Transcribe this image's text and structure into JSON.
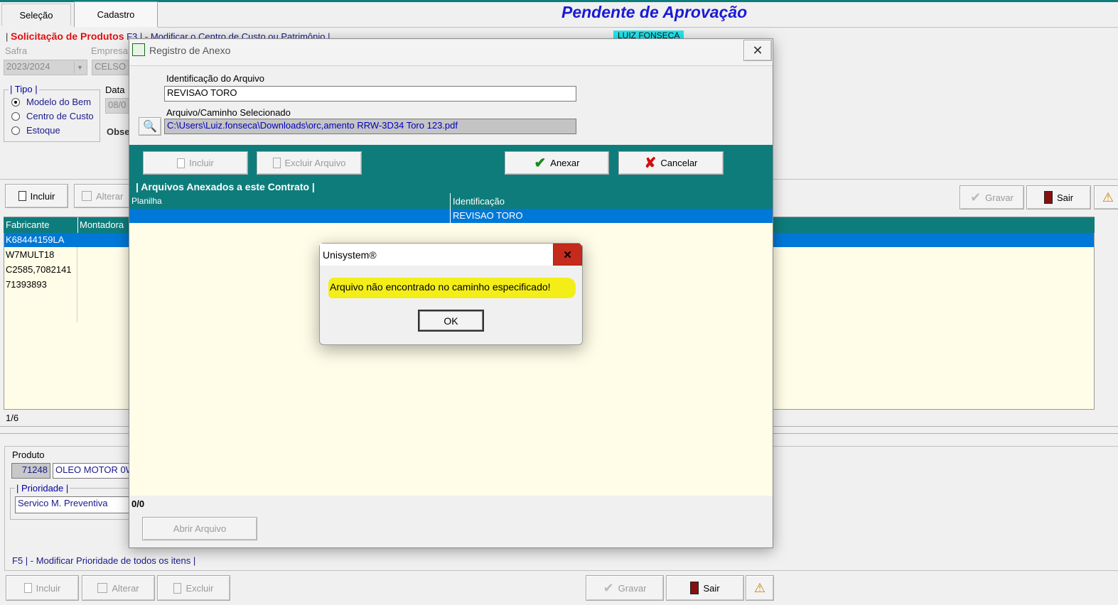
{
  "tabs": [
    {
      "label": "Seleção"
    },
    {
      "label": "Cadastro"
    }
  ],
  "status_title": "Pendente de Aprovação",
  "header_bar": {
    "section": "Solicitação de Produtos",
    "hint": "F3 | - Modificar o Centro de Custo ou Patrimônio |",
    "user_tag": "LUIZ FONSECA"
  },
  "filters": {
    "safra_label": "Safra",
    "safra_value": "2023/2024",
    "empresa_label": "Empresa",
    "empresa_value": "CELSO",
    "data_label": "Data",
    "data_value": "08/0",
    "obs_label": "Obse"
  },
  "tipo": {
    "title": "Tipo",
    "options": [
      {
        "label": "Modelo do Bem",
        "checked": true
      },
      {
        "label": "Centro de Custo",
        "checked": false
      },
      {
        "label": "Estoque",
        "checked": false
      }
    ]
  },
  "toolbar_top": {
    "incluir": "Incluir",
    "alterar": "Alterar",
    "gravar": "Gravar",
    "sair": "Sair"
  },
  "main_grid": {
    "columns": [
      "Fabricante",
      "Montadora"
    ],
    "rows": [
      {
        "fabricante": "K68444159LA"
      },
      {
        "fabricante": "W7MULT18"
      },
      {
        "fabricante": "C2585,7082141"
      },
      {
        "fabricante": "71393893"
      }
    ],
    "counter": "1/6"
  },
  "produto": {
    "label": "Produto",
    "code": "71248",
    "name": "OLEO MOTOR 0W",
    "prioridade_title": "Prioridade",
    "prioridade_value": "Servico M. Preventiva",
    "f5_hint": "F5 | - Modificar Prioridade de todos os itens |"
  },
  "toolbar_bottom": {
    "incluir": "Incluir",
    "alterar": "Alterar",
    "excluir": "Excluir",
    "gravar": "Gravar",
    "sair": "Sair"
  },
  "anexo_dialog": {
    "title": "Registro de Anexo",
    "ident_label": "Identificação do Arquivo",
    "ident_value": "REVISAO TORO",
    "path_label": "Arquivo/Caminho Selecionado",
    "path_value": "C:\\Users\\Luiz.fonseca\\Downloads\\orc,amento RRW-3D34 Toro 123.pdf",
    "btn_incluir": "Incluir",
    "btn_excluir": "Excluir Arquivo",
    "btn_anexar": "Anexar",
    "btn_cancelar": "Cancelar",
    "grid_title": "| Arquivos Anexados a este Contrato |",
    "col_planilha": "Planilha",
    "col_identificacao": "Identificação",
    "row_identificacao": "REVISAO TORO",
    "counter": "0/0",
    "btn_abrir": "Abrir Arquivo"
  },
  "message_box": {
    "title": "Unisystem®",
    "message": "Arquivo não encontrado no caminho especificado!",
    "ok": "OK"
  },
  "colors": {
    "teal": "#0f7c7c",
    "selection": "#0078d7",
    "grid_bg": "#fffde7",
    "title_blue": "#1a1ad6",
    "section_red": "#e01010"
  }
}
